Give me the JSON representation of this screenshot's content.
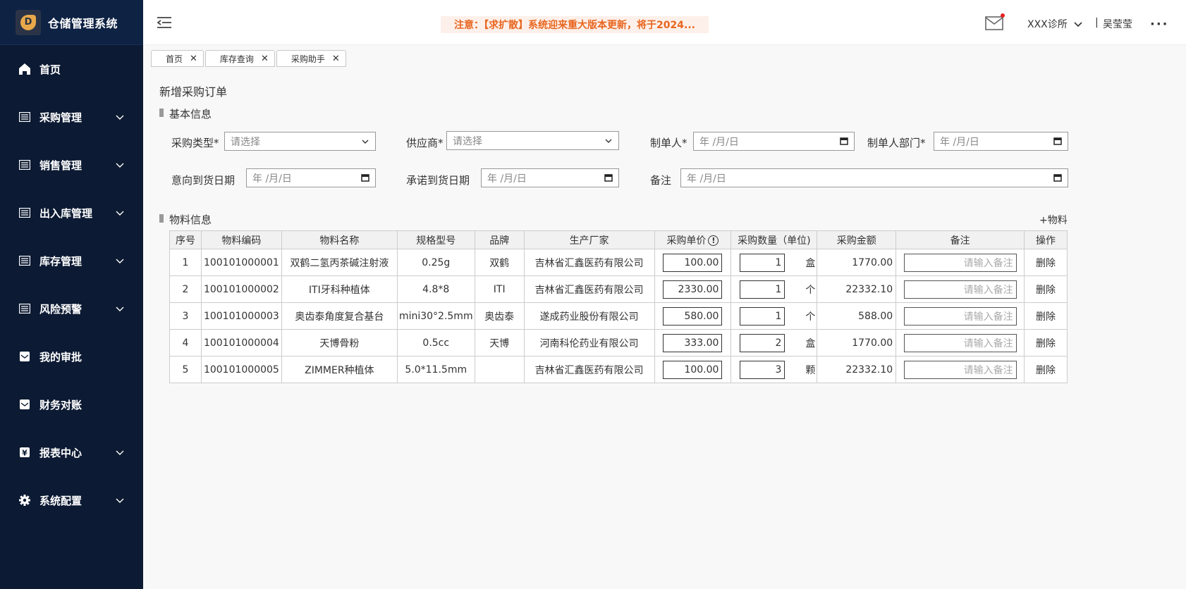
{
  "app": {
    "title": "仓储管理系统",
    "logo_letter": "D"
  },
  "sidebar": {
    "items": [
      {
        "label": "首页",
        "icon": "home-icon",
        "expandable": false
      },
      {
        "label": "采购管理",
        "icon": "list-icon",
        "expandable": true
      },
      {
        "label": "销售管理",
        "icon": "list-icon",
        "expandable": true
      },
      {
        "label": "出入库管理",
        "icon": "list-icon",
        "expandable": true
      },
      {
        "label": "库存管理",
        "icon": "list-icon",
        "expandable": true
      },
      {
        "label": "风险预警",
        "icon": "list-icon",
        "expandable": true
      },
      {
        "label": "我的审批",
        "icon": "mail-icon",
        "expandable": false
      },
      {
        "label": "财务对账",
        "icon": "mail-icon",
        "expandable": false
      },
      {
        "label": "报表中心",
        "icon": "yen-icon",
        "expandable": true
      },
      {
        "label": "系统配置",
        "icon": "gear-icon",
        "expandable": true
      }
    ]
  },
  "header": {
    "notice": "注意：【求扩散】系统迎来重大版本更新，将于2024...",
    "clinic": "XXX诊所",
    "separator": "|",
    "username": "吴莹莹",
    "more": "···"
  },
  "tabs": [
    {
      "label": "首页",
      "close": "✕"
    },
    {
      "label": "库存查询",
      "close": "✕"
    },
    {
      "label": "采购助手",
      "close": "✕"
    }
  ],
  "page": {
    "title": "新增采购订单",
    "basic_section": "基本信息",
    "material_section": "物料信息",
    "add_material": "+物料"
  },
  "form": {
    "purchase_type": {
      "label": "采购类型*",
      "placeholder": "请选择"
    },
    "supplier": {
      "label": "供应商*",
      "placeholder": "请选择"
    },
    "creator": {
      "label": "制单人*",
      "placeholder": "年 /月/日"
    },
    "creator_dept": {
      "label": "制单人部门*",
      "placeholder": "年 /月/日"
    },
    "intended_date": {
      "label": "意向到货日期",
      "placeholder": "年 /月/日"
    },
    "promised_date": {
      "label": "承诺到货日期",
      "placeholder": "年 /月/日"
    },
    "remark": {
      "label": "备注",
      "placeholder": "年 /月/日"
    }
  },
  "table": {
    "headers": [
      "序号",
      "物料编码",
      "物料名称",
      "规格型号",
      "品牌",
      "生产厂家",
      "采购单价",
      "采购数量（单位)",
      "采购金额",
      "备注",
      "操作"
    ],
    "info_icon": "!",
    "remark_placeholder": "请输入备注",
    "delete_label": "删除",
    "rows": [
      {
        "idx": "1",
        "code": "100101000001",
        "name": "双鹤二氢丙茶碱注射液",
        "spec": "0.25g",
        "brand": "双鹤",
        "maker": "吉林省汇鑫医药有限公司",
        "price": "100.00",
        "qty": "1",
        "unit": "盒",
        "amount": "1770.00"
      },
      {
        "idx": "2",
        "code": "100101000002",
        "name": "ITI牙科种植体",
        "spec": "4.8*8",
        "brand": "ITI",
        "maker": "吉林省汇鑫医药有限公司",
        "price": "2330.00",
        "qty": "1",
        "unit": "个",
        "amount": "22332.10"
      },
      {
        "idx": "3",
        "code": "100101000003",
        "name": "奥齿泰角度复合基台",
        "spec": "mini30°2.5mm",
        "brand": "奥齿泰",
        "maker": "遂成药业股份有限公司",
        "price": "580.00",
        "qty": "1",
        "unit": "个",
        "amount": "588.00"
      },
      {
        "idx": "4",
        "code": "100101000004",
        "name": "天博骨粉",
        "spec": "0.5cc",
        "brand": "天博",
        "maker": "河南科伦药业有限公司",
        "price": "333.00",
        "qty": "2",
        "unit": "盒",
        "amount": "1770.00"
      },
      {
        "idx": "5",
        "code": "100101000005",
        "name": "ZIMMER种植体",
        "spec": "5.0*11.5mm",
        "brand": "",
        "maker": "吉林省汇鑫医药有限公司",
        "price": "100.00",
        "qty": "3",
        "unit": "颗",
        "amount": "22332.10"
      }
    ]
  },
  "colors": {
    "sidebar_bg": "#0c1a33",
    "notice_text": "#e8661f",
    "notice_bg": "#fdf0ea",
    "mail_dot": "#e52020"
  }
}
